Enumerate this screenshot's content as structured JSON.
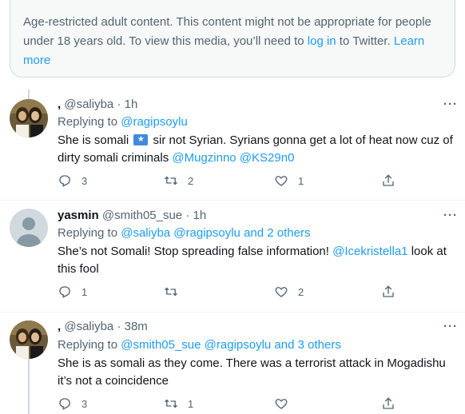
{
  "notice": {
    "text_before": "Age-restricted adult content. This content might not be appropriate for people under 18 years old. To view this media, you’ll need to ",
    "login_link": "log in",
    "text_middle": " to Twitter. ",
    "learn_more_link": "Learn more"
  },
  "tweets": [
    {
      "name": ",",
      "handle": "@saliyba",
      "time": "1h",
      "replying_label": "Replying to ",
      "replying_to": "@ragipsoylu",
      "body_before_flag": "She is somali ",
      "body_after_flag": " sir not Syrian. Syrians gonna get a lot of heat now cuz of dirty somali criminals ",
      "mentions": [
        "@Mugzinno",
        "@KS29n0"
      ],
      "counts": {
        "replies": "3",
        "retweets": "2",
        "likes": "1"
      }
    },
    {
      "name": "yasmin",
      "handle": "@smith05_sue",
      "time": "1h",
      "replying_label": "Replying to ",
      "replying_to": "@saliyba @ragipsoylu and 2 others",
      "body_before_mention": "She’s not Somali! Stop spreading false information! ",
      "mention": "@Icekristella1",
      "body_after_mention": " look at this fool",
      "counts": {
        "replies": "1",
        "retweets": "",
        "likes": "2"
      }
    },
    {
      "name": ",",
      "handle": "@saliyba",
      "time": "38m",
      "replying_label": "Replying to ",
      "replying_to": "@smith05_sue @ragipsoylu and 3 others",
      "body": "She is as somali as they come. There was a terrorist attack in Mogadishu it’s not a coincidence",
      "counts": {
        "replies": "3",
        "retweets": "1",
        "likes": ""
      }
    }
  ],
  "separator": "·",
  "icons": {
    "more": "more-icon",
    "reply": "reply-icon",
    "retweet": "retweet-icon",
    "like": "heart-icon",
    "share": "share-icon",
    "flag": "somalia-flag-icon"
  },
  "colors": {
    "link": "#1d9bf0",
    "muted": "#536471",
    "text": "#0f1419"
  }
}
